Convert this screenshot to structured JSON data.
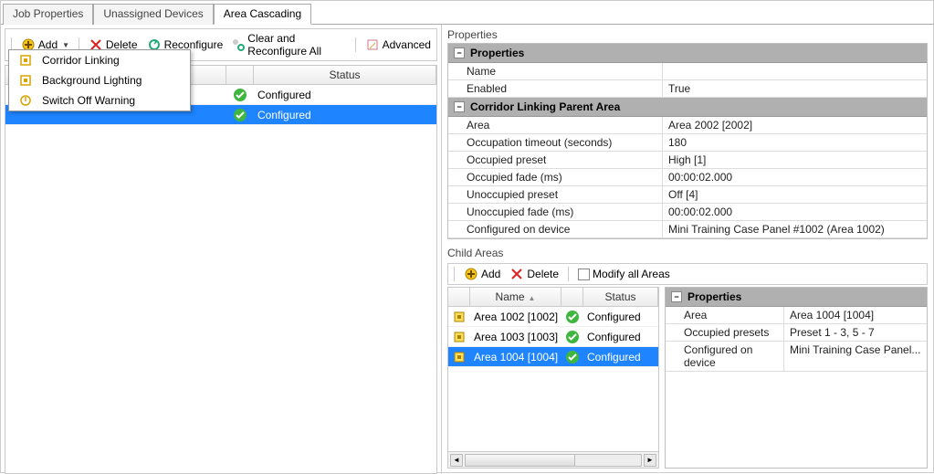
{
  "tabs": {
    "job": "Job Properties",
    "unassigned": "Unassigned Devices",
    "area": "Area Cascading"
  },
  "toolbar": {
    "add": "Add",
    "delete": "Delete",
    "reconfigure": "Reconfigure",
    "clear": "Clear and Reconfigure All",
    "advanced": "Advanced"
  },
  "menu": {
    "corridor": "Corridor Linking",
    "background": "Background Lighting",
    "switchoff": "Switch Off Warning"
  },
  "grid_headers": {
    "name": "Name",
    "status": "Status"
  },
  "main_rows": [
    {
      "name": "",
      "status": "Configured",
      "selected": false
    },
    {
      "name": "",
      "status": "Configured",
      "selected": true
    }
  ],
  "properties_label": "Properties",
  "prop_sections": {
    "properties_title": "Properties",
    "corridor_title": "Corridor Linking Parent Area",
    "rows1": [
      {
        "k": "Name",
        "v": ""
      },
      {
        "k": "Enabled",
        "v": "True"
      }
    ],
    "rows2": [
      {
        "k": "Area",
        "v": "Area 2002 [2002]"
      },
      {
        "k": "Occupation timeout (seconds)",
        "v": "180"
      },
      {
        "k": "Occupied preset",
        "v": "High [1]"
      },
      {
        "k": "Occupied fade (ms)",
        "v": "00:00:02.000"
      },
      {
        "k": "Unoccupied preset",
        "v": "Off [4]"
      },
      {
        "k": "Unoccupied fade (ms)",
        "v": "00:00:02.000"
      },
      {
        "k": "Configured on device",
        "v": "Mini Training Case Panel #1002 (Area 1002)"
      }
    ]
  },
  "child_label": "Child Areas",
  "child_tb": {
    "add": "Add",
    "delete": "Delete",
    "modify": "Modify all Areas"
  },
  "child_headers": {
    "name": "Name",
    "status": "Status"
  },
  "child_rows": [
    {
      "name": "Area 1002 [1002]",
      "status": "Configured",
      "selected": false
    },
    {
      "name": "Area 1003 [1003]",
      "status": "Configured",
      "selected": false
    },
    {
      "name": "Area 1004 [1004]",
      "status": "Configured",
      "selected": true
    }
  ],
  "child_props": {
    "title": "Properties",
    "rows": [
      {
        "k": "Area",
        "v": "Area 1004 [1004]"
      },
      {
        "k": "Occupied presets",
        "v": "Preset 1 - 3, 5 - 7"
      },
      {
        "k": "Configured on device",
        "v": "Mini Training Case Panel..."
      }
    ]
  }
}
